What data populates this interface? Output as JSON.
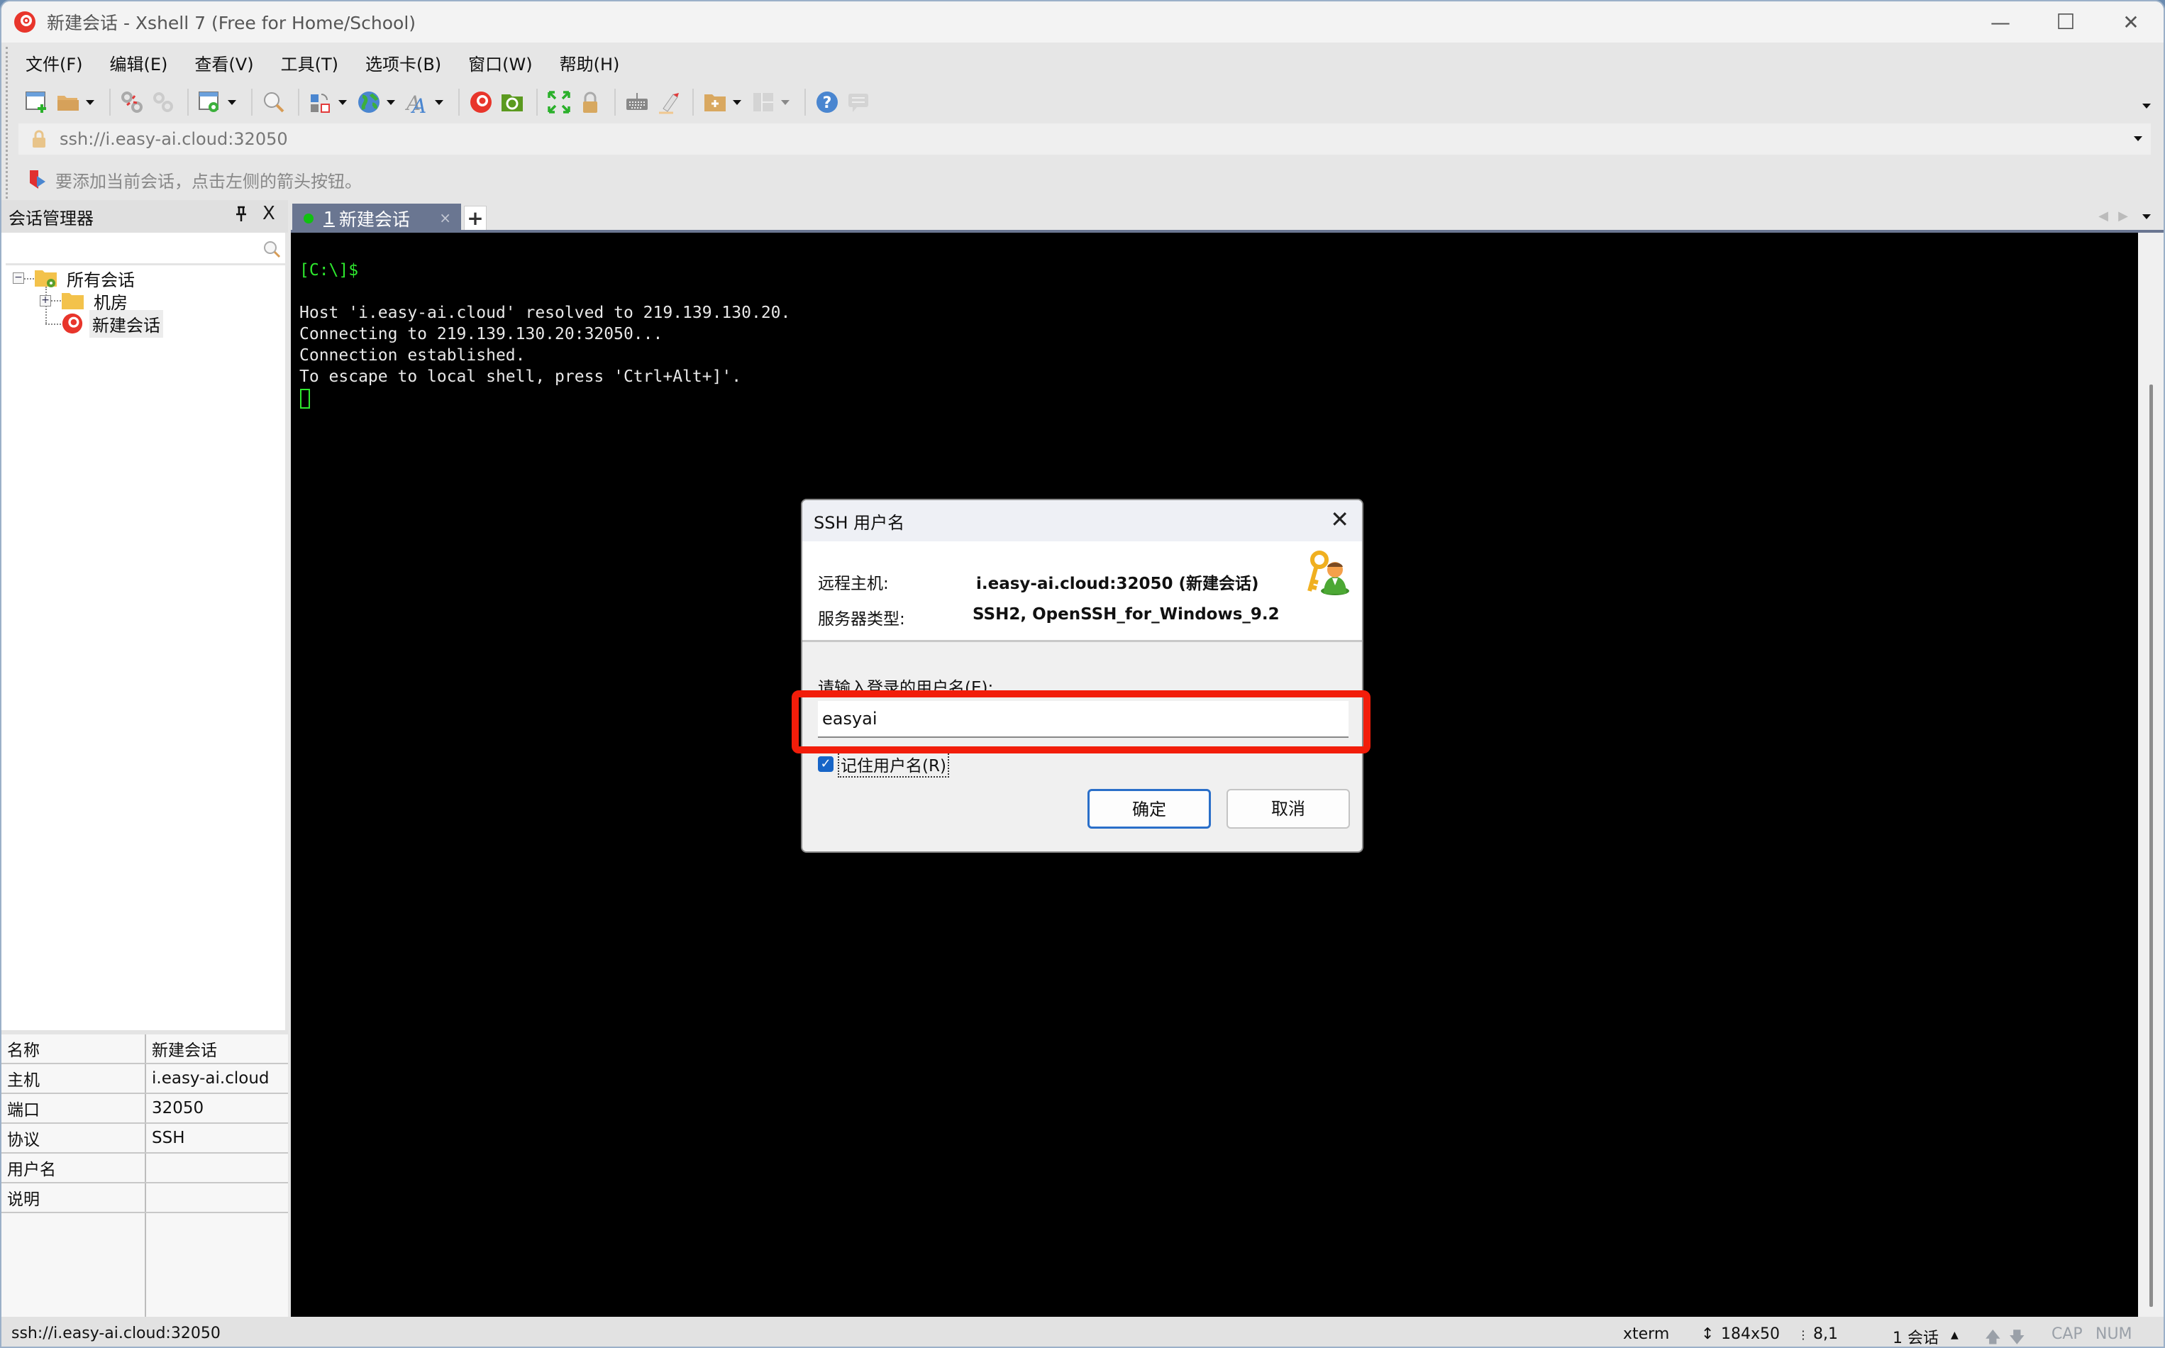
{
  "window": {
    "title": "新建会话 - Xshell 7 (Free for Home/School)",
    "controls": {
      "minimize": "—",
      "maximize": "☐",
      "close": "✕"
    }
  },
  "menu": [
    {
      "label": "文件(F)"
    },
    {
      "label": "编辑(E)"
    },
    {
      "label": "查看(V)"
    },
    {
      "label": "工具(T)"
    },
    {
      "label": "选项卡(B)"
    },
    {
      "label": "窗口(W)"
    },
    {
      "label": "帮助(H)"
    }
  ],
  "toolbar": {
    "icons": [
      "new-session",
      "open-folder",
      "disconnect",
      "reconnect",
      "session-properties",
      "find",
      "transfer",
      "globe",
      "font",
      "xshell",
      "xftp",
      "fullscreen",
      "lock",
      "keyboard",
      "highlight",
      "new-folder",
      "layout",
      "help",
      "chat"
    ]
  },
  "address_bar": {
    "value": "ssh://i.easy-ai.cloud:32050"
  },
  "hint_bar": {
    "text": "要添加当前会话，点击左侧的箭头按钮。"
  },
  "session_manager": {
    "title": "会话管理器",
    "pin": "ꟼ",
    "close": "X",
    "search_placeholder": "",
    "tree": [
      {
        "label": "所有会话",
        "expander": "−"
      },
      {
        "label": "机房",
        "expander": "+"
      },
      {
        "label": "新建会话",
        "selected": true
      }
    ],
    "properties": [
      {
        "key": "名称",
        "value": "新建会话"
      },
      {
        "key": "主机",
        "value": "i.easy-ai.cloud"
      },
      {
        "key": "端口",
        "value": "32050"
      },
      {
        "key": "协议",
        "value": "SSH"
      },
      {
        "key": "用户名",
        "value": ""
      },
      {
        "key": "说明",
        "value": ""
      }
    ]
  },
  "tabs": [
    {
      "number": "1",
      "label": "新建会话",
      "status_color": "#11c111",
      "active": true,
      "close": "×"
    }
  ],
  "tab_add": "+",
  "tab_nav": {
    "prev": "◀",
    "next": "▶"
  },
  "terminal": {
    "prompt": "[C:\\]$",
    "lines": [
      "Host 'i.easy-ai.cloud' resolved to 219.139.130.20.",
      "Connecting to 219.139.130.20:32050...",
      "Connection established.",
      "To escape to local shell, press 'Ctrl+Alt+]'."
    ]
  },
  "dialog": {
    "title": "SSH 用户名",
    "close": "✕",
    "remote_host_label": "远程主机:",
    "remote_host_value": "i.easy-ai.cloud:32050 (新建会话)",
    "server_type_label": "服务器类型:",
    "server_type_value": "SSH2, OpenSSH_for_Windows_9.2",
    "prompt": "请输入登录的用户名(E):",
    "username_value": "easyai",
    "remember_label": "记住用户名(R)",
    "remember_checked": true,
    "ok_label": "确定",
    "cancel_label": "取消"
  },
  "status_bar": {
    "address": "ssh://i.easy-ai.cloud:32050",
    "term_type": "xterm",
    "size": "184x50",
    "cursor_pos": "8,1",
    "sessions": "1 会话",
    "cap": "CAP",
    "num": "NUM"
  },
  "colors": {
    "highlight": "#f21d0a",
    "terminal_prompt": "#2ee82e",
    "tab_active": "#6a7691"
  }
}
